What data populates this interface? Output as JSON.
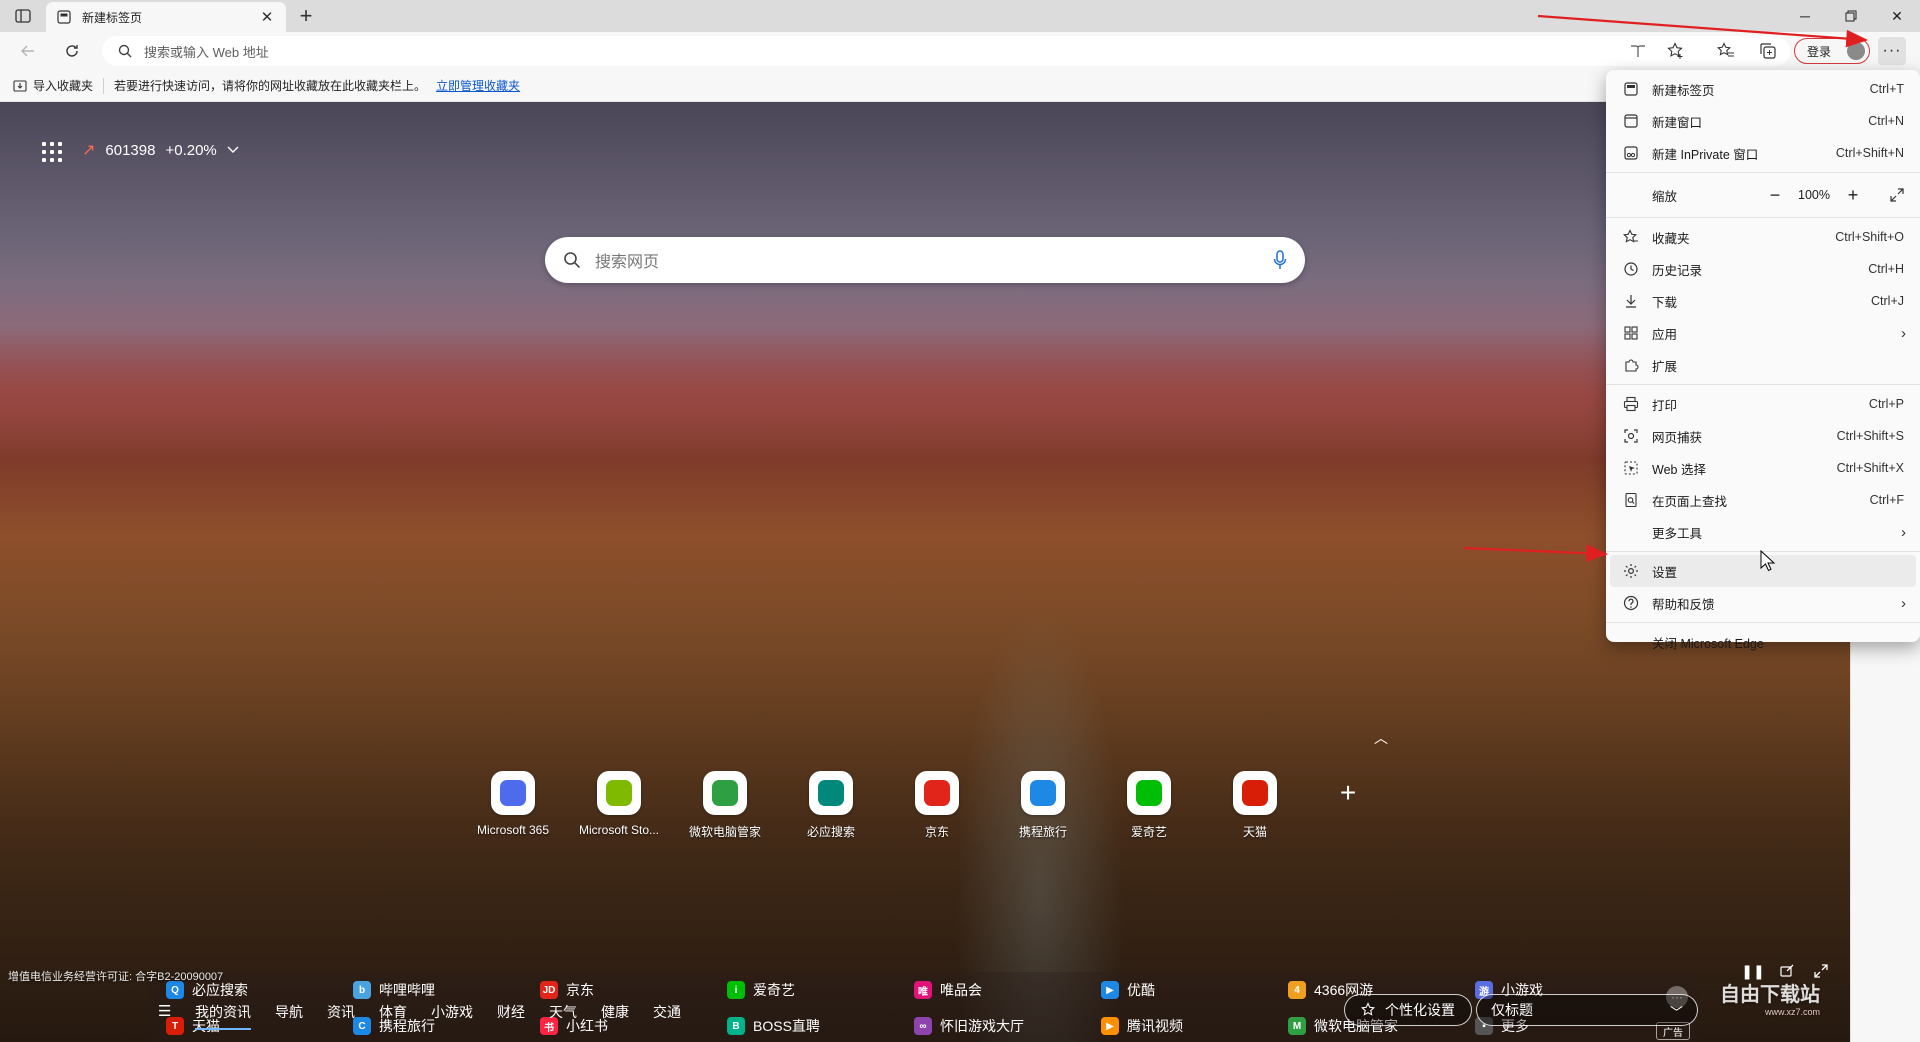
{
  "tab": {
    "title": "新建标签页"
  },
  "address": {
    "placeholder": "搜索或输入 Web 地址"
  },
  "toolbar": {
    "login_label": "登录"
  },
  "favbar": {
    "import_label": "导入收藏夹",
    "hint": "若要进行快速访问，请将你的网址收藏放在此收藏夹栏上。",
    "manage_link": "立即管理收藏夹"
  },
  "stock": {
    "code": "601398",
    "change": "+0.20%"
  },
  "search": {
    "placeholder": "搜索网页"
  },
  "quick_links": [
    {
      "label": "Microsoft 365",
      "icon": "m365-icon",
      "color": "#4f6bed"
    },
    {
      "label": "Microsoft Sto...",
      "icon": "store-icon",
      "color": "#7fba00"
    },
    {
      "label": "微软电脑管家",
      "icon": "pc-manager-icon",
      "color": "#2ea043"
    },
    {
      "label": "必应搜索",
      "icon": "bing-icon",
      "color": "#00897b"
    },
    {
      "label": "京东",
      "icon": "jd-icon",
      "color": "#e1251b"
    },
    {
      "label": "携程旅行",
      "icon": "ctrip-icon",
      "color": "#1e88e5"
    },
    {
      "label": "爱奇艺",
      "icon": "iqiyi-icon",
      "color": "#00be06"
    },
    {
      "label": "天猫",
      "icon": "tmall-icon",
      "color": "#d81e06"
    }
  ],
  "sites": {
    "row1": [
      {
        "label": "必应搜索",
        "color": "#1e88e5",
        "glyph": "Q"
      },
      {
        "label": "哔哩哔哩",
        "color": "#4aa3df",
        "glyph": "b"
      },
      {
        "label": "京东",
        "color": "#e1251b",
        "glyph": "JD"
      },
      {
        "label": "爱奇艺",
        "color": "#00be06",
        "glyph": "i"
      },
      {
        "label": "唯品会",
        "color": "#e0137b",
        "glyph": "唯"
      },
      {
        "label": "优酷",
        "color": "#1e88e5",
        "glyph": "▶"
      },
      {
        "label": "4366网游",
        "color": "#f0a020",
        "glyph": "4"
      },
      {
        "label": "小游戏",
        "color": "#5b6ee1",
        "glyph": "游"
      }
    ],
    "row2": [
      {
        "label": "天猫",
        "color": "#d81e06",
        "glyph": "T"
      },
      {
        "label": "携程旅行",
        "color": "#1e88e5",
        "glyph": "C"
      },
      {
        "label": "小红书",
        "color": "#ff2442",
        "glyph": "书"
      },
      {
        "label": "BOSS直聘",
        "color": "#00b38a",
        "glyph": "B"
      },
      {
        "label": "怀旧游戏大厅",
        "color": "#8e44ad",
        "glyph": "∞"
      },
      {
        "label": "腾讯视频",
        "color": "#ff8f00",
        "glyph": "▶"
      },
      {
        "label": "微软电脑管家",
        "color": "#2ea043",
        "glyph": "M"
      },
      {
        "label": "更多",
        "color": "#555555",
        "glyph": "▪"
      }
    ],
    "ad_label": "广告"
  },
  "icp": "增值电信业务经营许可证: 合字B2-20090007",
  "news": {
    "tabs": [
      "我的资讯",
      "导航",
      "资讯",
      "体育",
      "小游戏",
      "财经",
      "天气",
      "健康",
      "交通"
    ],
    "personalize_label": "个性化设置",
    "layout_value": "仅标题"
  },
  "menu": {
    "items_top": [
      {
        "label": "新建标签页",
        "shortcut": "Ctrl+T",
        "icon": "new-tab-icon"
      },
      {
        "label": "新建窗口",
        "shortcut": "Ctrl+N",
        "icon": "new-window-icon"
      },
      {
        "label": "新建 InPrivate 窗口",
        "shortcut": "Ctrl+Shift+N",
        "icon": "inprivate-icon"
      }
    ],
    "zoom": {
      "label": "缩放",
      "value": "100%"
    },
    "items_mid": [
      {
        "label": "收藏夹",
        "shortcut": "Ctrl+Shift+O",
        "icon": "favorites-icon"
      },
      {
        "label": "历史记录",
        "shortcut": "Ctrl+H",
        "icon": "history-icon"
      },
      {
        "label": "下载",
        "shortcut": "Ctrl+J",
        "icon": "download-icon"
      },
      {
        "label": "应用",
        "shortcut": "",
        "icon": "apps-icon"
      },
      {
        "label": "扩展",
        "shortcut": "",
        "icon": "extensions-icon"
      }
    ],
    "items_tools": [
      {
        "label": "打印",
        "shortcut": "Ctrl+P",
        "icon": "print-icon"
      },
      {
        "label": "网页捕获",
        "shortcut": "Ctrl+Shift+S",
        "icon": "capture-icon"
      },
      {
        "label": "Web 选择",
        "shortcut": "Ctrl+Shift+X",
        "icon": "web-select-icon"
      },
      {
        "label": "在页面上查找",
        "shortcut": "Ctrl+F",
        "icon": "find-icon"
      },
      {
        "label": "更多工具",
        "shortcut": "",
        "icon": "more-tools-icon"
      }
    ],
    "settings": {
      "label": "设置"
    },
    "help": {
      "label": "帮助和反馈"
    },
    "close": {
      "label": "关闭 Microsoft Edge"
    }
  },
  "watermark": {
    "name": "自由下载站",
    "url": "www.xz7.com"
  },
  "colors": {
    "accent_red": "#e02020",
    "link_blue": "#0b57d0"
  }
}
